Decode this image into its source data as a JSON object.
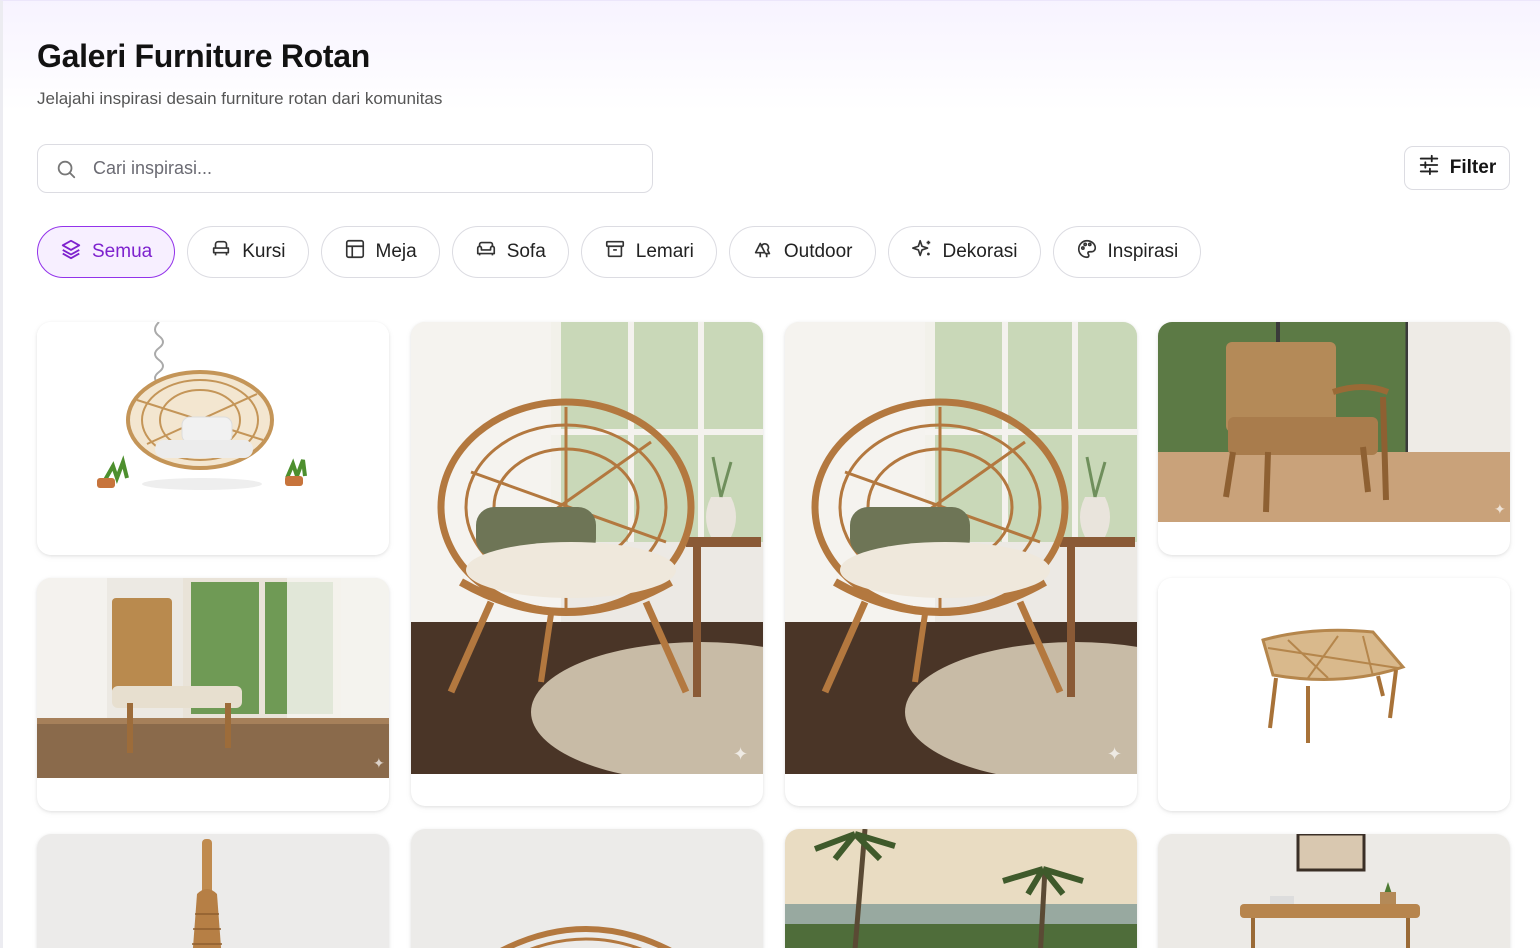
{
  "header": {
    "title": "Galeri Furniture Rotan",
    "subtitle": "Jelajahi inspirasi desain furniture rotan dari komunitas"
  },
  "search": {
    "placeholder": "Cari inspirasi...",
    "value": "",
    "icon": "search-icon"
  },
  "filter": {
    "label": "Filter",
    "icon": "sliders-icon"
  },
  "categories": [
    {
      "label": "Semua",
      "icon": "layers-icon",
      "active": true
    },
    {
      "label": "Kursi",
      "icon": "armchair-icon",
      "active": false
    },
    {
      "label": "Meja",
      "icon": "table-icon",
      "active": false
    },
    {
      "label": "Sofa",
      "icon": "sofa-icon",
      "active": false
    },
    {
      "label": "Lemari",
      "icon": "cabinet-icon",
      "active": false
    },
    {
      "label": "Outdoor",
      "icon": "trees-icon",
      "active": false
    },
    {
      "label": "Dekorasi",
      "icon": "sparkles-icon",
      "active": false
    },
    {
      "label": "Inspirasi",
      "icon": "palette-icon",
      "active": false
    }
  ],
  "gallery": [
    {
      "subject": "hanging-egg-chair"
    },
    {
      "subject": "round-papasan-chair"
    },
    {
      "subject": "round-papasan-chair"
    },
    {
      "subject": "woven-armchair"
    },
    {
      "subject": "high-back-chair"
    },
    {
      "subject": "rattan-bench"
    },
    {
      "subject": "rattan-chair-leg"
    },
    {
      "subject": "round-chair"
    },
    {
      "subject": "tropical-outdoor"
    },
    {
      "subject": "console-table"
    }
  ],
  "colors": {
    "accent": "#9333ea",
    "accent_bg": "#f7efff",
    "rattan": "#b98a4e"
  }
}
